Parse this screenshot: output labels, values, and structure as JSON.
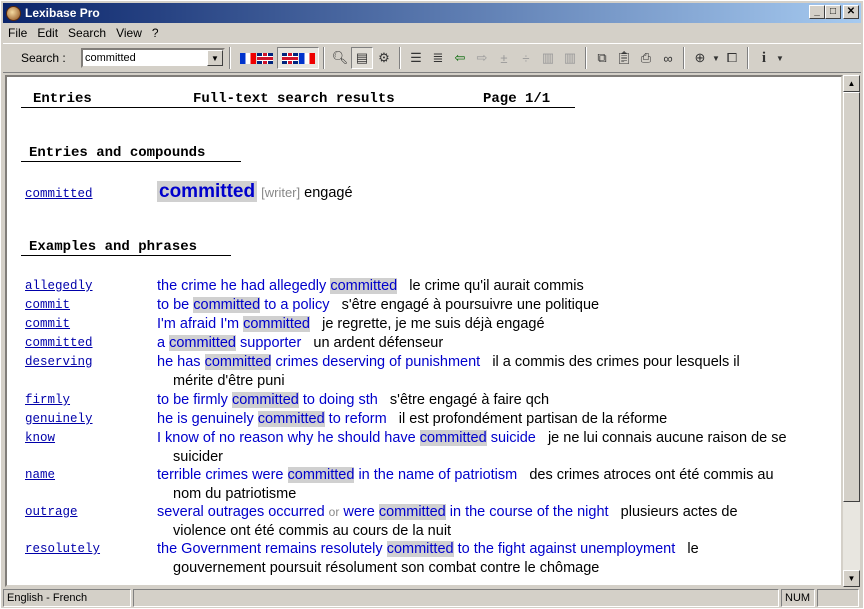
{
  "window": {
    "title": "Lexibase Pro"
  },
  "menu": [
    "File",
    "Edit",
    "Search",
    "View",
    "?"
  ],
  "toolbar": {
    "search_label": "Search :",
    "search_value": "committed"
  },
  "header": {
    "entries": "Entries",
    "title": "Full-text search results",
    "page": "Page 1/1"
  },
  "sections": {
    "entries": "Entries and compounds",
    "examples": "Examples and phrases"
  },
  "entry": {
    "link": "committed",
    "headword": "committed",
    "label": "[writer]",
    "translation": "engagé"
  },
  "examples": [
    {
      "key": "allegedly",
      "en_pre": "the crime he had allegedly ",
      "hl": "committed",
      "en_post": "",
      "fr": "le crime qu'il aurait commis",
      "cont": ""
    },
    {
      "key": "commit",
      "en_pre": "to be ",
      "hl": "committed",
      "en_post": " to a policy",
      "fr": "s'être engagé à poursuivre une politique",
      "cont": ""
    },
    {
      "key": "commit",
      "en_pre": "I'm afraid I'm ",
      "hl": "committed",
      "en_post": "",
      "fr": "je regrette, je me suis déjà engagé",
      "cont": ""
    },
    {
      "key": "committed",
      "en_pre": "a ",
      "hl": "committed",
      "en_post": " supporter",
      "fr": "un ardent défenseur",
      "cont": ""
    },
    {
      "key": "deserving",
      "en_pre": "he has ",
      "hl": "committed",
      "en_post": " crimes deserving of punishment",
      "fr": "il a commis des crimes pour lesquels il",
      "cont": "mérite d'être puni"
    },
    {
      "key": "firmly",
      "en_pre": "to be firmly ",
      "hl": "committed",
      "en_post": " to doing sth",
      "fr": "s'être engagé à faire qch",
      "cont": ""
    },
    {
      "key": "genuinely",
      "en_pre": "he is genuinely ",
      "hl": "committed",
      "en_post": " to reform",
      "fr": "il est profondément partisan de la réforme",
      "cont": ""
    },
    {
      "key": "know",
      "en_pre": "I know of no reason why he should have ",
      "hl": "committed",
      "en_post": " suicide",
      "fr": "je ne lui connais aucune raison de se",
      "cont": "suicider"
    },
    {
      "key": "name",
      "en_pre": "terrible crimes were ",
      "hl": "committed",
      "en_post": " in the name of patriotism",
      "fr": "des crimes atroces ont été commis au",
      "cont": "nom du patriotisme"
    },
    {
      "key": "outrage",
      "en_pre": "several outrages occurred ",
      "or": "or",
      "en_mid": " were ",
      "hl": "committed",
      "en_post": " in the course of the night",
      "fr": "plusieurs actes de",
      "cont": "violence ont été commis au cours de la nuit"
    },
    {
      "key": "resolutely",
      "en_pre": "the Government remains resolutely ",
      "hl": "committed",
      "en_post": " to the fight against unemployment",
      "fr": "le",
      "cont": "gouvernement poursuit résolument son combat contre le chômage"
    }
  ],
  "status": {
    "lang": "English - French",
    "num": "NUM"
  }
}
